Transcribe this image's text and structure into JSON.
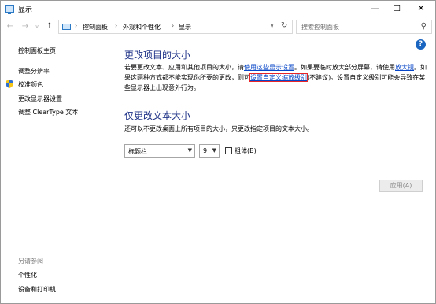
{
  "window": {
    "title": "显示",
    "minimize": "—",
    "maximize": "☐",
    "close": "✕"
  },
  "nav": {
    "back": "←",
    "forward": "→",
    "recent": "∨",
    "up": "↑"
  },
  "address": {
    "sep": "›",
    "crumbs": [
      "控制面板",
      "外观和个性化",
      "显示"
    ],
    "dropdown": "∨",
    "refresh": "↻"
  },
  "search": {
    "placeholder": "搜索控制面板",
    "icon": "⚲"
  },
  "help": "?",
  "left_pane": {
    "home": "控制面板主页",
    "items": [
      "调整分辨率",
      "校准颜色",
      "更改显示器设置",
      "调整 ClearType 文本"
    ],
    "see_also_title": "另请参阅",
    "see_also_items": [
      "个性化",
      "设备和打印机"
    ]
  },
  "main": {
    "heading1": "更改项目的大小",
    "para_part1": "若要更改文本、应用和其他项目的大小，请",
    "link1": "使用这些显示设置",
    "para_part2": "。如果要临时放大部分屏幕，请使用",
    "link2": "放大镜",
    "para_part3": "。如果这两种方式都不能实现你所要的更改，则可",
    "link3": "设置自定义缩放级别",
    "para_part4": "(不建议)。设置自定义级别可能会导致在某些显示器上出现意外行为。",
    "heading2": "仅更改文本大小",
    "sub_desc": "还可以不更改桌面上所有项目的大小，只更改指定项目的文本大小。",
    "item_select": "标题栏",
    "size_select": "9",
    "bold_label": "粗体(B)",
    "apply": "应用(A)"
  },
  "colors": {
    "heading": "#1e3287",
    "link": "#0645c7",
    "highlight_border": "#e8262a"
  }
}
